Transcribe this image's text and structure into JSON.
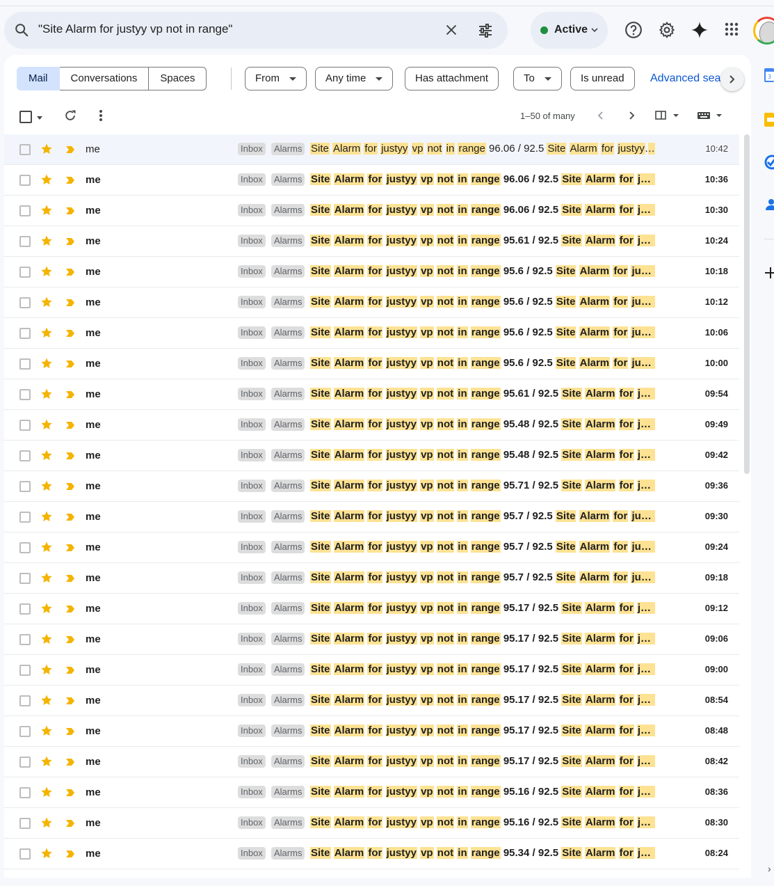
{
  "search": {
    "query": "\"Site Alarm for justyy vp not in range\""
  },
  "status": {
    "label": "Active"
  },
  "tabs": [
    "Mail",
    "Conversations",
    "Spaces"
  ],
  "filters": [
    "From",
    "Any time",
    "Has attachment",
    "To",
    "Is unread"
  ],
  "advanced_search": "Advanced search",
  "pagination": "1–50 of many",
  "labels": {
    "inbox": "Inbox",
    "alarms": "Alarms"
  },
  "subject_words": [
    "Site",
    "Alarm",
    "for",
    "justyy",
    "vp",
    "not",
    "in",
    "range"
  ],
  "rows": [
    {
      "sender": "me",
      "value": "96.06",
      "threshold": "92.5",
      "time": "10:42",
      "read": true
    },
    {
      "sender": "me",
      "value": "96.06",
      "threshold": "92.5",
      "time": "10:36",
      "read": false
    },
    {
      "sender": "me",
      "value": "96.06",
      "threshold": "92.5",
      "time": "10:30",
      "read": false
    },
    {
      "sender": "me",
      "value": "95.61",
      "threshold": "92.5",
      "time": "10:24",
      "read": false
    },
    {
      "sender": "me",
      "value": "95.6",
      "threshold": "92.5",
      "time": "10:18",
      "read": false
    },
    {
      "sender": "me",
      "value": "95.6",
      "threshold": "92.5",
      "time": "10:12",
      "read": false
    },
    {
      "sender": "me",
      "value": "95.6",
      "threshold": "92.5",
      "time": "10:06",
      "read": false
    },
    {
      "sender": "me",
      "value": "95.6",
      "threshold": "92.5",
      "time": "10:00",
      "read": false
    },
    {
      "sender": "me",
      "value": "95.61",
      "threshold": "92.5",
      "time": "09:54",
      "read": false
    },
    {
      "sender": "me",
      "value": "95.48",
      "threshold": "92.5",
      "time": "09:49",
      "read": false
    },
    {
      "sender": "me",
      "value": "95.48",
      "threshold": "92.5",
      "time": "09:42",
      "read": false
    },
    {
      "sender": "me",
      "value": "95.71",
      "threshold": "92.5",
      "time": "09:36",
      "read": false
    },
    {
      "sender": "me",
      "value": "95.7",
      "threshold": "92.5",
      "time": "09:30",
      "read": false
    },
    {
      "sender": "me",
      "value": "95.7",
      "threshold": "92.5",
      "time": "09:24",
      "read": false
    },
    {
      "sender": "me",
      "value": "95.7",
      "threshold": "92.5",
      "time": "09:18",
      "read": false
    },
    {
      "sender": "me",
      "value": "95.17",
      "threshold": "92.5",
      "time": "09:12",
      "read": false
    },
    {
      "sender": "me",
      "value": "95.17",
      "threshold": "92.5",
      "time": "09:06",
      "read": false
    },
    {
      "sender": "me",
      "value": "95.17",
      "threshold": "92.5",
      "time": "09:00",
      "read": false
    },
    {
      "sender": "me",
      "value": "95.17",
      "threshold": "92.5",
      "time": "08:54",
      "read": false
    },
    {
      "sender": "me",
      "value": "95.17",
      "threshold": "92.5",
      "time": "08:48",
      "read": false
    },
    {
      "sender": "me",
      "value": "95.17",
      "threshold": "92.5",
      "time": "08:42",
      "read": false
    },
    {
      "sender": "me",
      "value": "95.16",
      "threshold": "92.5",
      "time": "08:36",
      "read": false
    },
    {
      "sender": "me",
      "value": "95.16",
      "threshold": "92.5",
      "time": "08:30",
      "read": false
    },
    {
      "sender": "me",
      "value": "95.34",
      "threshold": "92.5",
      "time": "08:24",
      "read": false
    }
  ]
}
